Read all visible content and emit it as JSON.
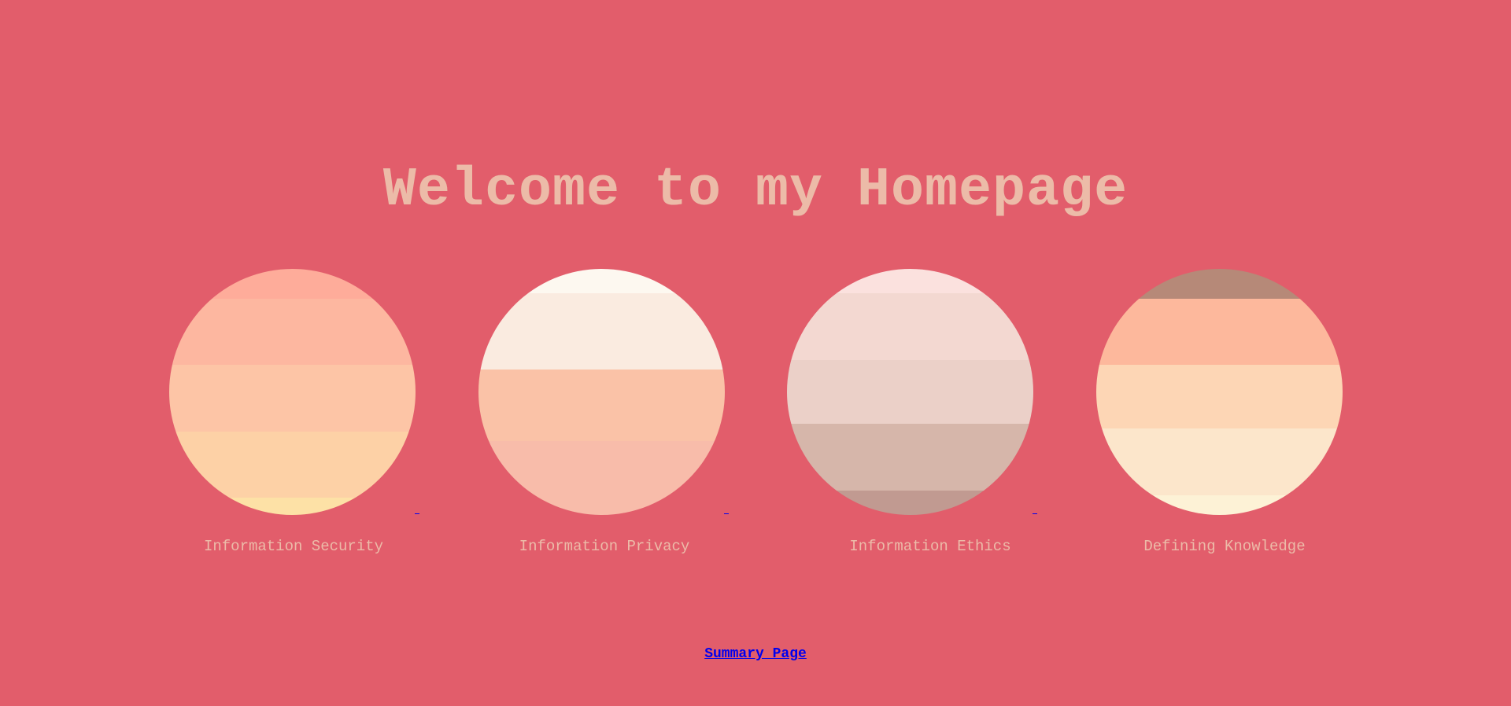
{
  "page": {
    "title": "Welcome to my Homepage",
    "background_color": "#e25d6b",
    "text_color": "#ecbba8",
    "link_color": "#0000ee"
  },
  "planets": [
    {
      "label": "Information Security",
      "bands": [
        "#feac9a",
        "#fdb7a0",
        "#fdc5a6",
        "#fdd1a6",
        "#fde1a6"
      ]
    },
    {
      "label": "Information Privacy",
      "bands": [
        "#fdf8f0",
        "#faebe0",
        "#fac2a7",
        "#f8bcaa"
      ]
    },
    {
      "label": "Information Ethics",
      "bands": [
        "#fbe1de",
        "#f3d8d1",
        "#ebd0c8",
        "#d6b6aa",
        "#c19a91"
      ]
    },
    {
      "label": "Defining Knowledge",
      "bands": [
        "#b68978",
        "#fdb89c",
        "#fdd6b5",
        "#fce6cb",
        "#fdf2d6"
      ]
    }
  ],
  "footer": {
    "summary_link": "Summary Page"
  }
}
